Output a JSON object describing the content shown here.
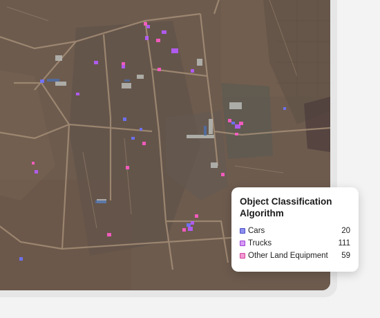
{
  "legend": {
    "title": "Object Classification Algorithm",
    "items": [
      {
        "label": "Cars",
        "count": "20",
        "color": "#8d8ff0",
        "border": "#4a4dc4"
      },
      {
        "label": "Trucks",
        "count": "111",
        "color": "#d79cf6",
        "border": "#9a3fd1"
      },
      {
        "label": "Other Land Equipment",
        "count": "59",
        "color": "#f29bd3",
        "border": "#d13f9e"
      }
    ]
  },
  "detection_colors": {
    "cars": "#6f73ff",
    "trucks": "#b85cff",
    "other_land_equipment": "#ff5cc8"
  }
}
